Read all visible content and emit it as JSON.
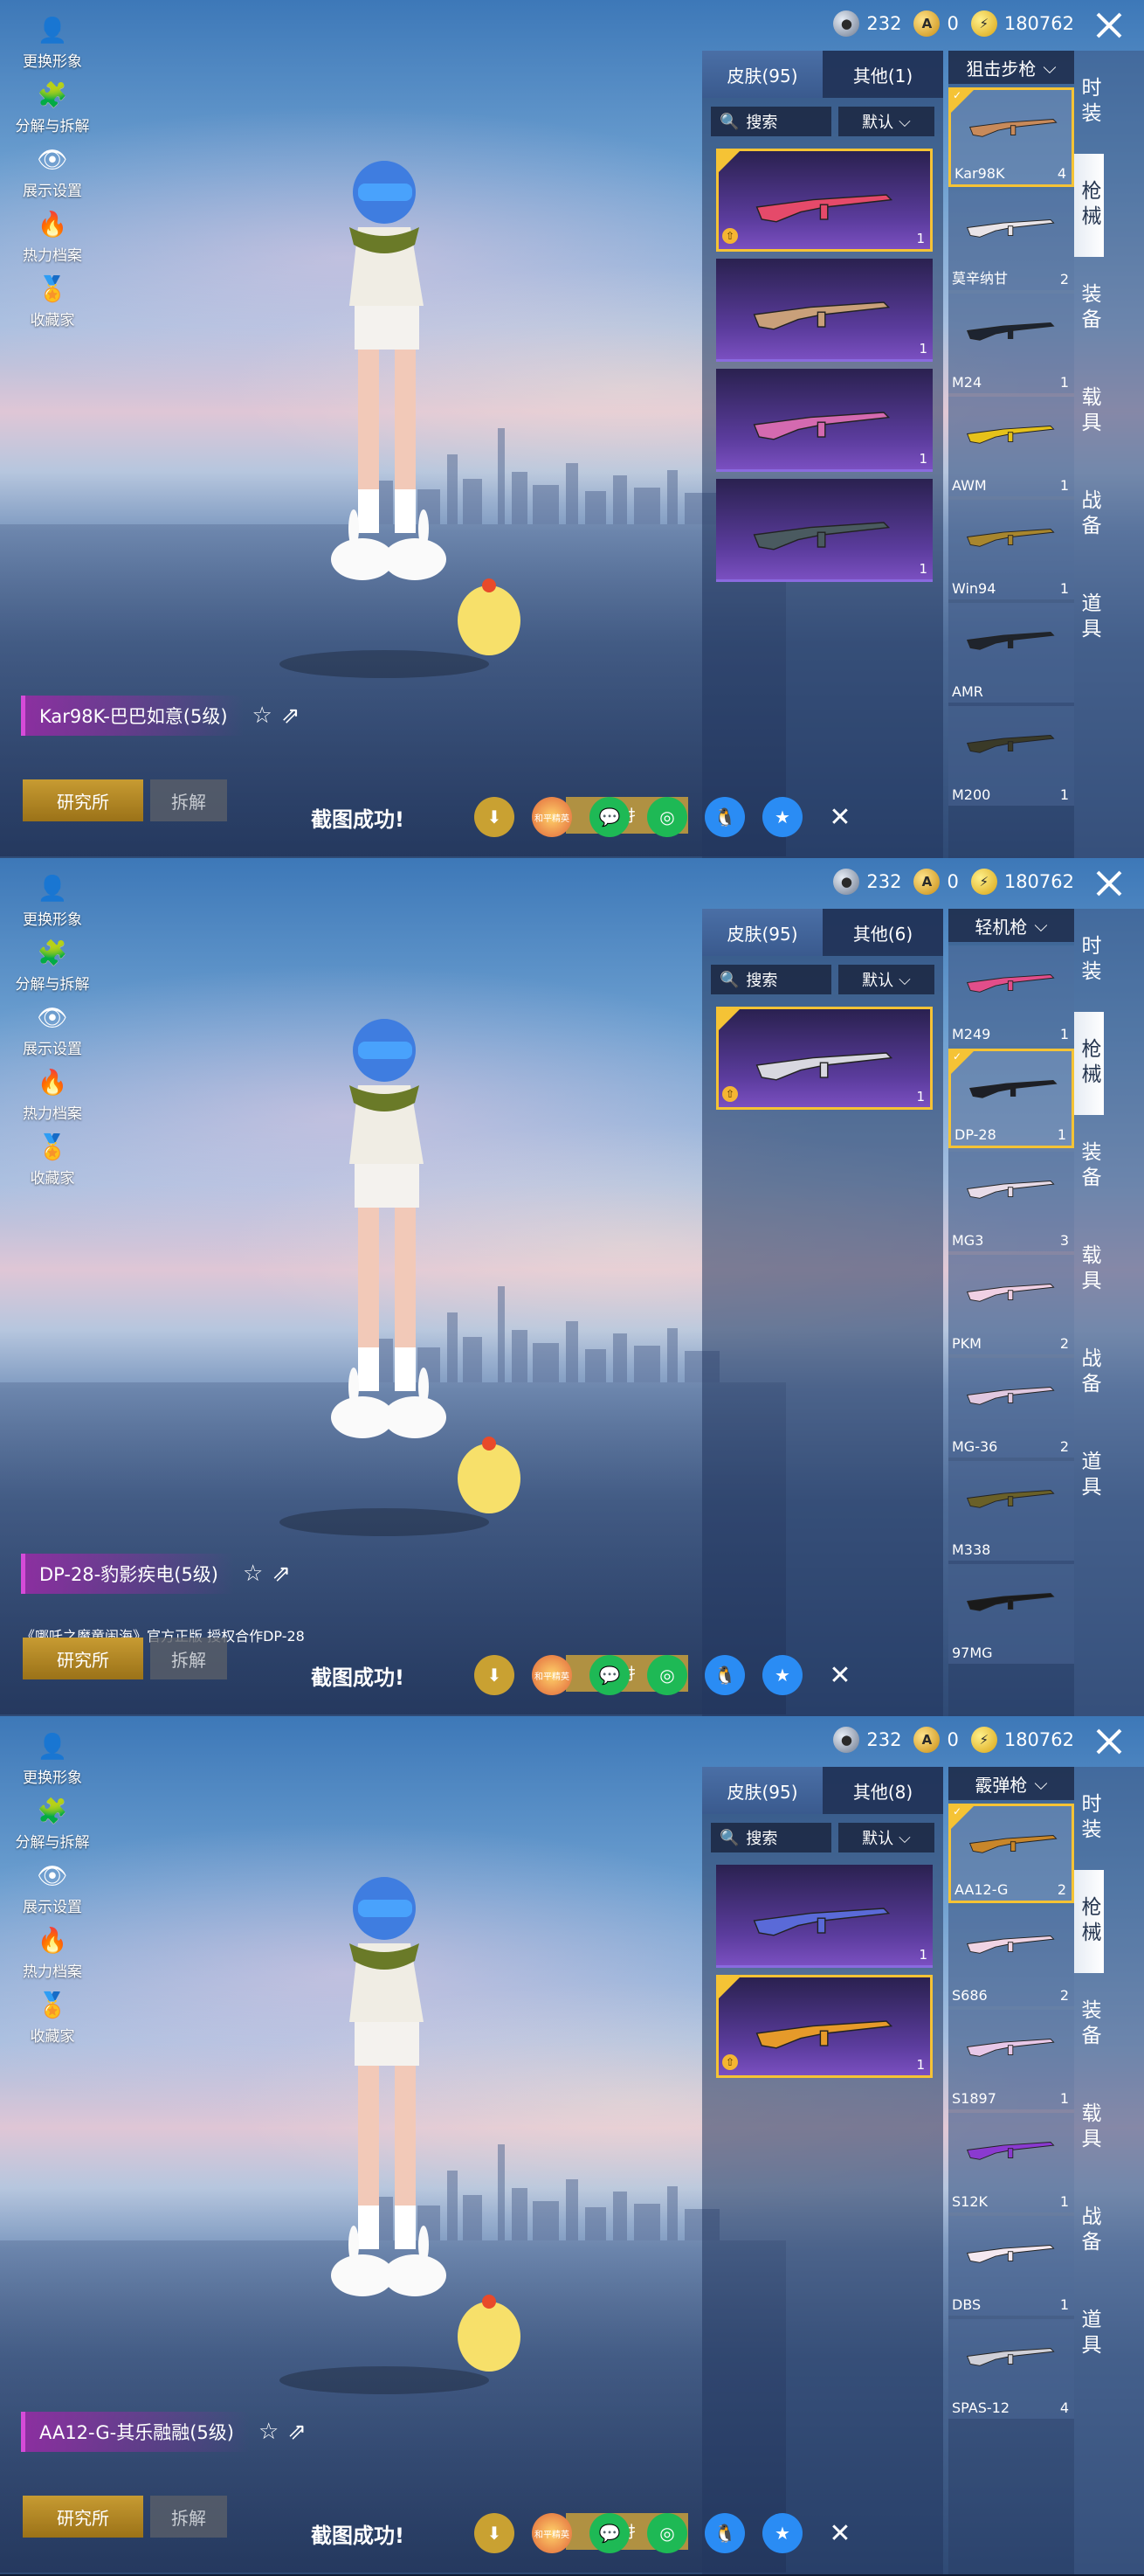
{
  "side_menu": [
    "更换形象",
    "分解与拆解",
    "展示设置",
    "热力档案",
    "收藏家"
  ],
  "currency": {
    "silver": "232",
    "gold": "0",
    "coupon": "180762"
  },
  "categories": [
    "时装",
    "枪械",
    "装备",
    "载具",
    "战备",
    "道具"
  ],
  "common": {
    "search": "搜索",
    "sort": "默认",
    "research": "研究所",
    "disassemble": "拆解",
    "screenshot_ok": "截图成功!",
    "share_pk": "和平精英",
    "store_hint": "存扌"
  },
  "panels": [
    {
      "weapon_type": "狙击步枪",
      "tab_skins": "皮肤(95)",
      "tab_other": "其他(1)",
      "name": "Kar98K-巴巴如意(5级)",
      "license": "",
      "skins": [
        {
          "count": "1",
          "selected": true,
          "color": "#e54a6a"
        },
        {
          "count": "1",
          "selected": false,
          "color": "#c9a07a"
        },
        {
          "count": "1",
          "selected": false,
          "color": "#d46ab0"
        },
        {
          "count": "1",
          "selected": false,
          "color": "#4a5a60"
        }
      ],
      "weapons": [
        {
          "name": "Kar98K",
          "count": "4",
          "selected": true,
          "color": "#c88a5a"
        },
        {
          "name": "莫辛纳甘",
          "count": "2",
          "selected": false,
          "color": "#e9e4e8"
        },
        {
          "name": "M24",
          "count": "1",
          "selected": false,
          "color": "#1d2430"
        },
        {
          "name": "AWM",
          "count": "1",
          "selected": false,
          "color": "#e6c21a"
        },
        {
          "name": "Win94",
          "count": "1",
          "selected": false,
          "color": "#a8862e"
        },
        {
          "name": "AMR",
          "count": "",
          "selected": false,
          "color": "#1f242c"
        },
        {
          "name": "M200",
          "count": "1",
          "selected": false,
          "color": "#3a3a28"
        }
      ]
    },
    {
      "weapon_type": "轻机枪",
      "tab_skins": "皮肤(95)",
      "tab_other": "其他(6)",
      "name": "DP-28-豹影疾电(5级)",
      "license": "《哪吒之魔童闹海》官方正版 授权合作DP-28",
      "skins": [
        {
          "count": "1",
          "selected": true,
          "color": "#d8d8e0"
        }
      ],
      "weapons": [
        {
          "name": "M249",
          "count": "1",
          "selected": false,
          "color": "#e24e8a"
        },
        {
          "name": "DP-28",
          "count": "1",
          "selected": true,
          "color": "#1d1f26"
        },
        {
          "name": "MG3",
          "count": "3",
          "selected": false,
          "color": "#e8dce8"
        },
        {
          "name": "PKM",
          "count": "2",
          "selected": false,
          "color": "#f0d0e4"
        },
        {
          "name": "MG-36",
          "count": "2",
          "selected": false,
          "color": "#e0c8e0"
        },
        {
          "name": "M338",
          "count": "",
          "selected": false,
          "color": "#6a6028"
        },
        {
          "name": "97MG",
          "count": "",
          "selected": false,
          "color": "#1a1a1a"
        }
      ]
    },
    {
      "weapon_type": "霰弹枪",
      "tab_skins": "皮肤(95)",
      "tab_other": "其他(8)",
      "name": "AA12-G-其乐融融(5级)",
      "license": "",
      "skins": [
        {
          "count": "1",
          "selected": false,
          "color": "#5a6ad8"
        },
        {
          "count": "1",
          "selected": true,
          "color": "#e69a2a"
        }
      ],
      "weapons": [
        {
          "name": "AA12-G",
          "count": "2",
          "selected": true,
          "color": "#c8862a"
        },
        {
          "name": "S686",
          "count": "2",
          "selected": false,
          "color": "#f0d4e4"
        },
        {
          "name": "S1897",
          "count": "1",
          "selected": false,
          "color": "#e8c8e8"
        },
        {
          "name": "S12K",
          "count": "1",
          "selected": false,
          "color": "#8a3ad0"
        },
        {
          "name": "DBS",
          "count": "1",
          "selected": false,
          "color": "#f4e8f0"
        },
        {
          "name": "SPAS-12",
          "count": "4",
          "selected": false,
          "color": "#d0d0d8"
        }
      ]
    }
  ]
}
